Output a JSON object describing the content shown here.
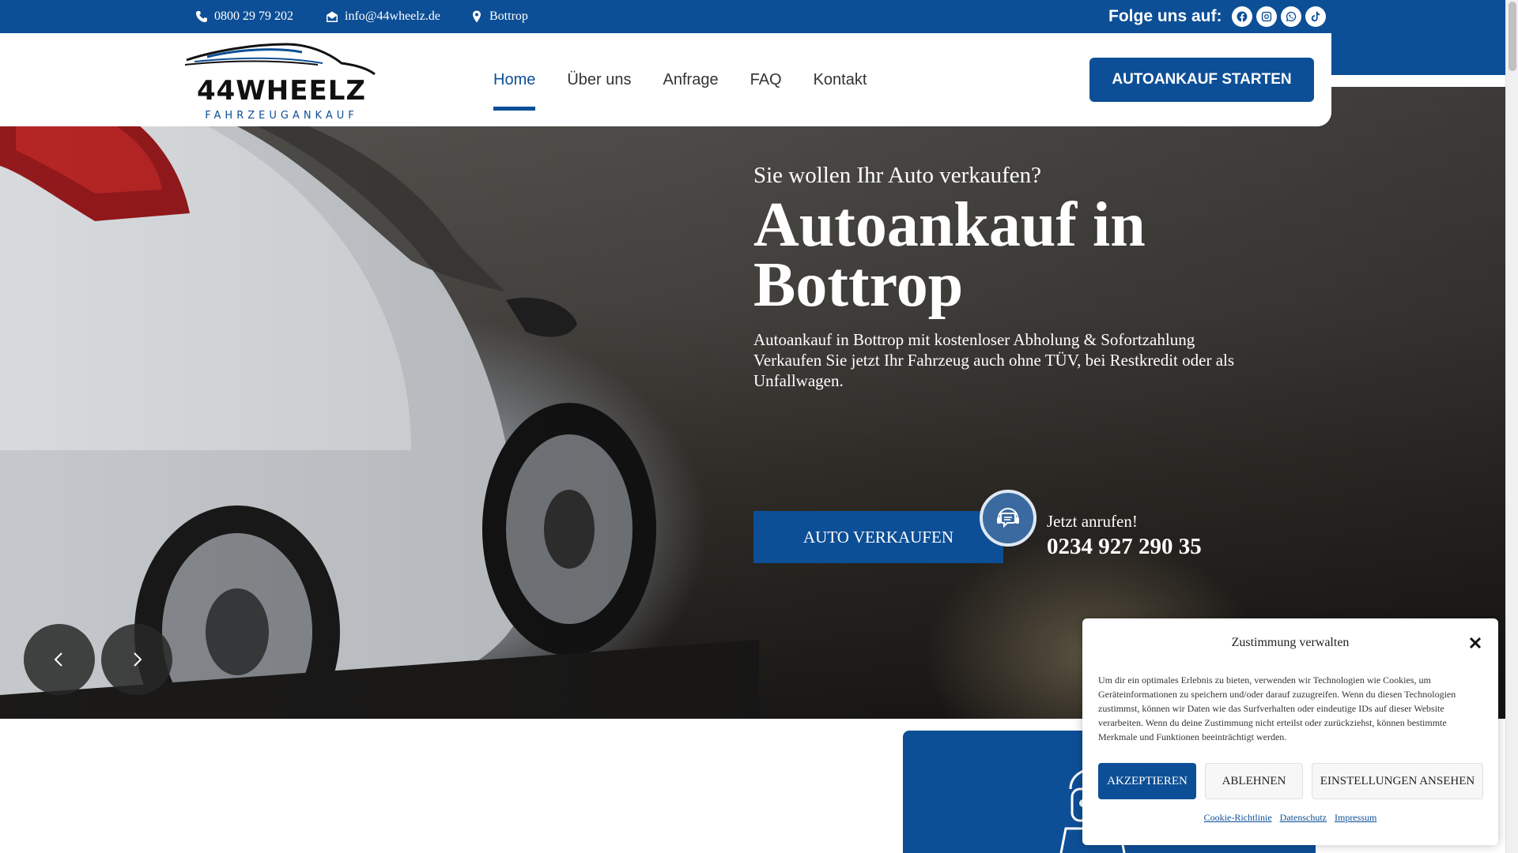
{
  "topbar": {
    "phone": "0800 29 79 202",
    "email": "info@44wheelz.de",
    "location": "Bottrop",
    "follow_label": "Folge uns auf:",
    "socials": [
      "facebook-icon",
      "instagram-icon",
      "whatsapp-icon",
      "tiktok-icon"
    ]
  },
  "header": {
    "logo_text": "44WHEELZ",
    "logo_sub": "FAHRZEUGANKAUF",
    "nav": [
      {
        "label": "Home",
        "active": true
      },
      {
        "label": "Über uns",
        "active": false
      },
      {
        "label": "Anfrage",
        "active": false
      },
      {
        "label": "FAQ",
        "active": false
      },
      {
        "label": "Kontakt",
        "active": false
      }
    ],
    "cta_label": "AUTOANKAUF STARTEN"
  },
  "hero": {
    "subtitle": "Sie wollen Ihr Auto verkaufen?",
    "title_line1": "Autoankauf in",
    "title_line2": "Bottrop",
    "desc_line1": "Autoankauf in Bottrop mit kostenloser Abholung & Sofortzahlung",
    "desc_line2": "Verkaufen Sie jetzt Ihr Fahrzeug auch ohne TÜV, bei Restkredit oder als Unfallwagen.",
    "button_label": "AUTO VERKAUFEN",
    "call_label": "Jetzt anrufen!",
    "call_number": "0234 927 290 35"
  },
  "cookie": {
    "title": "Zustimmung verwalten",
    "text": "Um dir ein optimales Erlebnis zu bieten, verwenden wir Technologien wie Cookies, um Geräteinformationen zu speichern und/oder darauf zuzugreifen. Wenn du diesen Technologien zustimmst, können wir Daten wie das Surfverhalten oder eindeutige IDs auf dieser Website verarbeiten. Wenn du deine Zustimmung nicht erteilst oder zurückziehst, können bestimmte Merkmale und Funktionen beeinträchtigt werden.",
    "accept": "AKZEPTIEREN",
    "deny": "ABLEHNEN",
    "prefs": "EINSTELLUNGEN ANSEHEN",
    "links": [
      "Cookie-Richtlinie",
      "Datenschutz",
      "Impressum"
    ]
  },
  "colors": {
    "brand": "#0d4f96",
    "white": "#ffffff"
  }
}
